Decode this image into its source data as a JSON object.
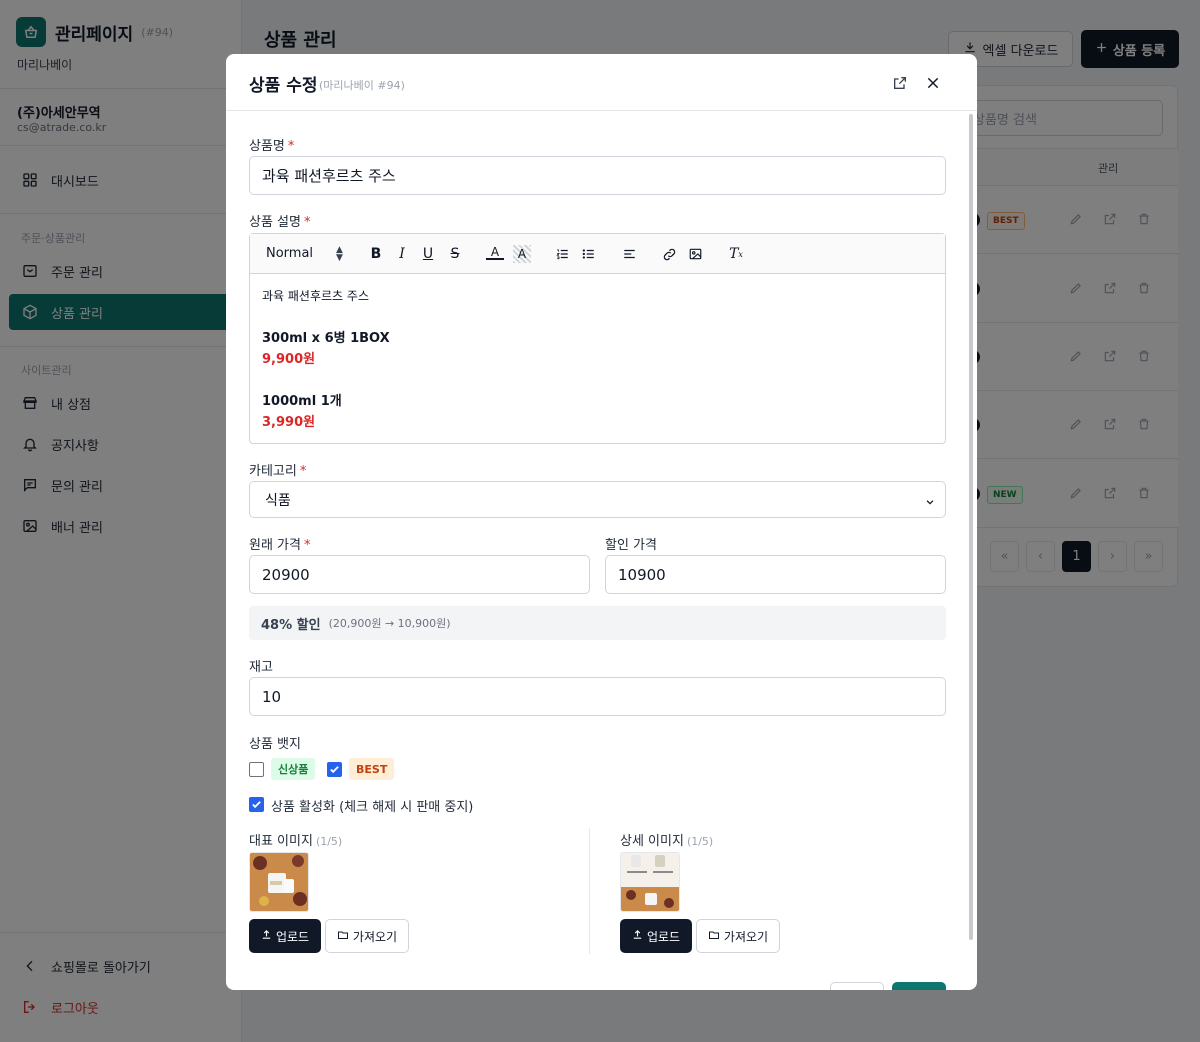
{
  "sidebar": {
    "brand_title": "관리페이지",
    "brand_id": "(#94)",
    "store_name": "마리나베이",
    "company": "(주)아세안무역",
    "email": "cs@atrade.co.kr",
    "dashboard": "대시보드",
    "section_orders": "주문·상품관리",
    "orders": "주문 관리",
    "products": "상품 관리",
    "section_site": "사이트관리",
    "my_store": "내 상점",
    "notice": "공지사항",
    "inquiry": "문의 관리",
    "banner": "배너 관리",
    "back_to_mall": "쇼핑몰로 돌아가기",
    "logout": "로그아웃"
  },
  "main": {
    "title": "상품 관리",
    "excel_download": "엑셀 다운로드",
    "register": "상품 등록",
    "search_placeholder": "상품명 검색",
    "col_manage": "관리",
    "row_badges": [
      "BEST",
      "",
      "",
      "",
      "NEW"
    ],
    "current_page": "1"
  },
  "modal": {
    "title": "상품 수정",
    "subtitle": "(마리나베이 #94)",
    "name_label": "상품명",
    "name_value": "과육 패션후르츠 주스",
    "desc_label": "상품 설명",
    "format_select": "Normal",
    "desc": {
      "line1": "과육 패션후르츠 주스",
      "opt1": "300ml x 6병 1BOX",
      "price1": "9,900원",
      "opt2": "1000ml 1개",
      "price2": "3,990원"
    },
    "category_label": "카테고리",
    "category_value": "식품",
    "orig_price_label": "원래 가격",
    "orig_price_value": "20900",
    "sale_price_label": "할인 가격",
    "sale_price_value": "10900",
    "discount_pct": "48% 할인",
    "discount_detail": "(20,900원 → 10,900원)",
    "stock_label": "재고",
    "stock_value": "10",
    "badge_label": "상품 뱃지",
    "badge_new": "신상품",
    "badge_new_checked": false,
    "badge_best": "BEST",
    "badge_best_checked": true,
    "active_label": "상품 활성화 (체크 해제 시 판매 중지)",
    "active_checked": true,
    "main_image_label": "대표 이미지",
    "main_image_count": "(1/5)",
    "detail_image_label": "상세 이미지",
    "detail_image_count": "(1/5)",
    "upload": "업로드",
    "import": "가져오기"
  },
  "colors": {
    "accent": "#0f766e",
    "primary_dark": "#111827",
    "required": "#dc2626",
    "checkbox": "#2563eb"
  }
}
